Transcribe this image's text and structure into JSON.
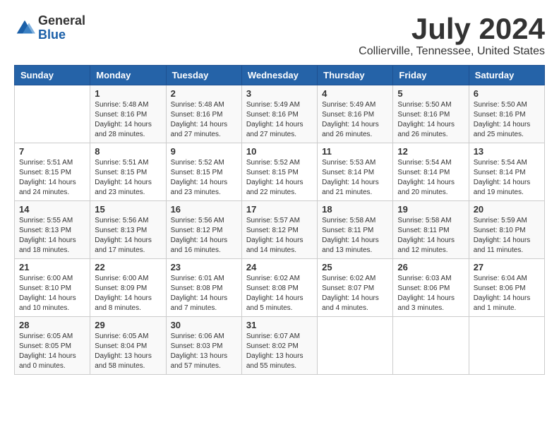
{
  "logo": {
    "text_general": "General",
    "text_blue": "Blue"
  },
  "title": "July 2024",
  "location": "Collierville, Tennessee, United States",
  "weekdays": [
    "Sunday",
    "Monday",
    "Tuesday",
    "Wednesday",
    "Thursday",
    "Friday",
    "Saturday"
  ],
  "weeks": [
    [
      {
        "day": "",
        "detail": ""
      },
      {
        "day": "1",
        "detail": "Sunrise: 5:48 AM\nSunset: 8:16 PM\nDaylight: 14 hours\nand 28 minutes."
      },
      {
        "day": "2",
        "detail": "Sunrise: 5:48 AM\nSunset: 8:16 PM\nDaylight: 14 hours\nand 27 minutes."
      },
      {
        "day": "3",
        "detail": "Sunrise: 5:49 AM\nSunset: 8:16 PM\nDaylight: 14 hours\nand 27 minutes."
      },
      {
        "day": "4",
        "detail": "Sunrise: 5:49 AM\nSunset: 8:16 PM\nDaylight: 14 hours\nand 26 minutes."
      },
      {
        "day": "5",
        "detail": "Sunrise: 5:50 AM\nSunset: 8:16 PM\nDaylight: 14 hours\nand 26 minutes."
      },
      {
        "day": "6",
        "detail": "Sunrise: 5:50 AM\nSunset: 8:16 PM\nDaylight: 14 hours\nand 25 minutes."
      }
    ],
    [
      {
        "day": "7",
        "detail": "Sunrise: 5:51 AM\nSunset: 8:15 PM\nDaylight: 14 hours\nand 24 minutes."
      },
      {
        "day": "8",
        "detail": "Sunrise: 5:51 AM\nSunset: 8:15 PM\nDaylight: 14 hours\nand 23 minutes."
      },
      {
        "day": "9",
        "detail": "Sunrise: 5:52 AM\nSunset: 8:15 PM\nDaylight: 14 hours\nand 23 minutes."
      },
      {
        "day": "10",
        "detail": "Sunrise: 5:52 AM\nSunset: 8:15 PM\nDaylight: 14 hours\nand 22 minutes."
      },
      {
        "day": "11",
        "detail": "Sunrise: 5:53 AM\nSunset: 8:14 PM\nDaylight: 14 hours\nand 21 minutes."
      },
      {
        "day": "12",
        "detail": "Sunrise: 5:54 AM\nSunset: 8:14 PM\nDaylight: 14 hours\nand 20 minutes."
      },
      {
        "day": "13",
        "detail": "Sunrise: 5:54 AM\nSunset: 8:14 PM\nDaylight: 14 hours\nand 19 minutes."
      }
    ],
    [
      {
        "day": "14",
        "detail": "Sunrise: 5:55 AM\nSunset: 8:13 PM\nDaylight: 14 hours\nand 18 minutes."
      },
      {
        "day": "15",
        "detail": "Sunrise: 5:56 AM\nSunset: 8:13 PM\nDaylight: 14 hours\nand 17 minutes."
      },
      {
        "day": "16",
        "detail": "Sunrise: 5:56 AM\nSunset: 8:12 PM\nDaylight: 14 hours\nand 16 minutes."
      },
      {
        "day": "17",
        "detail": "Sunrise: 5:57 AM\nSunset: 8:12 PM\nDaylight: 14 hours\nand 14 minutes."
      },
      {
        "day": "18",
        "detail": "Sunrise: 5:58 AM\nSunset: 8:11 PM\nDaylight: 14 hours\nand 13 minutes."
      },
      {
        "day": "19",
        "detail": "Sunrise: 5:58 AM\nSunset: 8:11 PM\nDaylight: 14 hours\nand 12 minutes."
      },
      {
        "day": "20",
        "detail": "Sunrise: 5:59 AM\nSunset: 8:10 PM\nDaylight: 14 hours\nand 11 minutes."
      }
    ],
    [
      {
        "day": "21",
        "detail": "Sunrise: 6:00 AM\nSunset: 8:10 PM\nDaylight: 14 hours\nand 10 minutes."
      },
      {
        "day": "22",
        "detail": "Sunrise: 6:00 AM\nSunset: 8:09 PM\nDaylight: 14 hours\nand 8 minutes."
      },
      {
        "day": "23",
        "detail": "Sunrise: 6:01 AM\nSunset: 8:08 PM\nDaylight: 14 hours\nand 7 minutes."
      },
      {
        "day": "24",
        "detail": "Sunrise: 6:02 AM\nSunset: 8:08 PM\nDaylight: 14 hours\nand 5 minutes."
      },
      {
        "day": "25",
        "detail": "Sunrise: 6:02 AM\nSunset: 8:07 PM\nDaylight: 14 hours\nand 4 minutes."
      },
      {
        "day": "26",
        "detail": "Sunrise: 6:03 AM\nSunset: 8:06 PM\nDaylight: 14 hours\nand 3 minutes."
      },
      {
        "day": "27",
        "detail": "Sunrise: 6:04 AM\nSunset: 8:06 PM\nDaylight: 14 hours\nand 1 minute."
      }
    ],
    [
      {
        "day": "28",
        "detail": "Sunrise: 6:05 AM\nSunset: 8:05 PM\nDaylight: 14 hours\nand 0 minutes."
      },
      {
        "day": "29",
        "detail": "Sunrise: 6:05 AM\nSunset: 8:04 PM\nDaylight: 13 hours\nand 58 minutes."
      },
      {
        "day": "30",
        "detail": "Sunrise: 6:06 AM\nSunset: 8:03 PM\nDaylight: 13 hours\nand 57 minutes."
      },
      {
        "day": "31",
        "detail": "Sunrise: 6:07 AM\nSunset: 8:02 PM\nDaylight: 13 hours\nand 55 minutes."
      },
      {
        "day": "",
        "detail": ""
      },
      {
        "day": "",
        "detail": ""
      },
      {
        "day": "",
        "detail": ""
      }
    ]
  ]
}
